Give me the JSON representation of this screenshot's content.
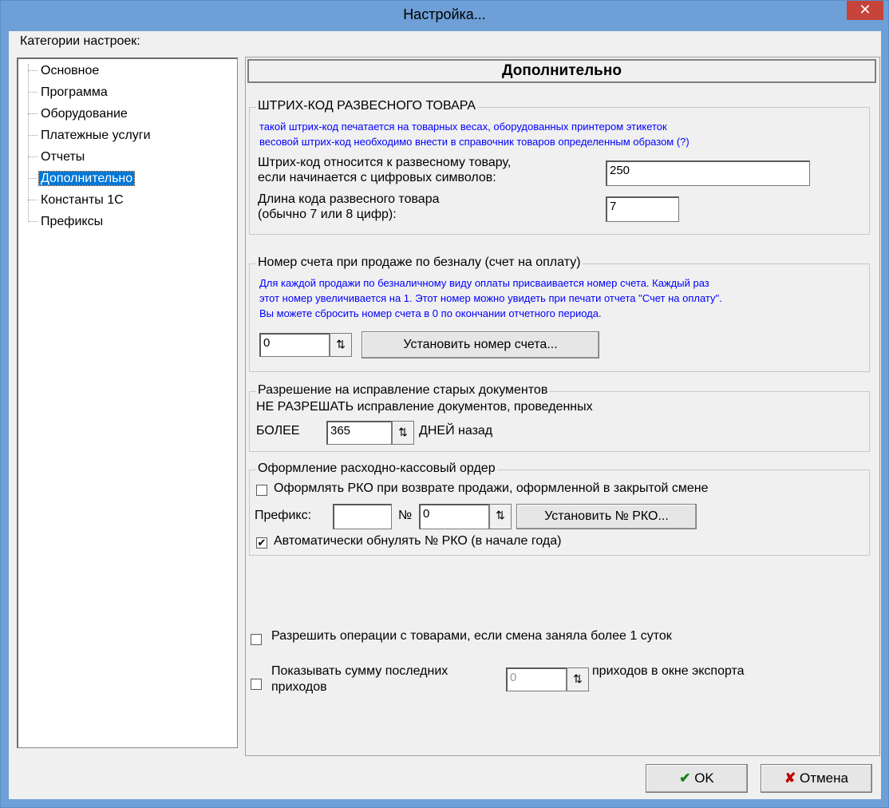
{
  "window": {
    "title": "Настройка...",
    "close_glyph": "✕"
  },
  "sidebar": {
    "label": "Категории настроек:",
    "items": [
      {
        "label": "Основное"
      },
      {
        "label": "Программа"
      },
      {
        "label": "Оборудование"
      },
      {
        "label": "Платежные услуги"
      },
      {
        "label": "Отчеты"
      },
      {
        "label": "Дополнительно",
        "selected": true
      },
      {
        "label": "Константы 1С"
      },
      {
        "label": "Префиксы"
      }
    ]
  },
  "main": {
    "header": "Дополнительно",
    "barcode": {
      "title": "ШТРИХ-КОД РАЗВЕСНОГО ТОВАРА",
      "hint1": "такой штрих-код печатается на товарных весах, оборудованных принтером этикеток",
      "hint2": "весовой штрих-код необходимо внести в справочник товаров определенным образом (?)",
      "prefix_label1": "Штрих-код относится к развесному товару,",
      "prefix_label2": "если начинается с цифровых символов:",
      "prefix_value": "250",
      "length_label1": "Длина кода развесного товара",
      "length_label2": "(обычно 7 или 8 цифр):",
      "length_value": "7"
    },
    "invoice": {
      "title": "Номер счета при продаже по безналу (счет на оплату)",
      "hint1": "Для каждой продажи по безналичному виду оплаты присваивается номер счета. Каждый раз",
      "hint2": "этот номер увеличивается на 1. Этот номер можно увидеть при печати отчета \"Счет на оплату\".",
      "hint3": "Вы можете сбросить номер счета в 0 по окончании отчетного периода.",
      "number_value": "0",
      "set_button": "Установить номер счета..."
    },
    "old_docs": {
      "title": "Разрешение на исправление старых документов",
      "line1_bold": "НЕ РАЗРЕШАТЬ",
      "line1_rest": " исправление документов, проведенных",
      "before": "БОЛЕЕ",
      "days_value": "365",
      "after": "ДНЕЙ назад"
    },
    "rko": {
      "title": "Оформление расходно-кассовый ордер",
      "return_checkbox_label": "Оформлять РКО при возврате продажи, оформленной в закрытой смене",
      "return_checked": false,
      "prefix_label": "Префикс:",
      "prefix_value": "",
      "number_sign": "№",
      "number_value": "0",
      "set_button": "Установить № РКО...",
      "auto_reset_label": "Автоматически обнулять № РКО (в начале года)",
      "auto_reset_checked": true
    },
    "allow_ops_label": "Разрешить операции с товарами, если  смена заняла более 1 суток",
    "show_sum_label1": "Показывать сумму последних",
    "show_sum_value": "0",
    "show_sum_label2": "приходов в окне экспорта",
    "show_sum_label3": "приходов"
  },
  "footer": {
    "ok_label": "OK",
    "cancel_label": "Отмена"
  },
  "icons": {
    "spin": "spinner-icon",
    "ok": "checkmark-icon",
    "cancel": "cross-icon",
    "check": "✔"
  }
}
